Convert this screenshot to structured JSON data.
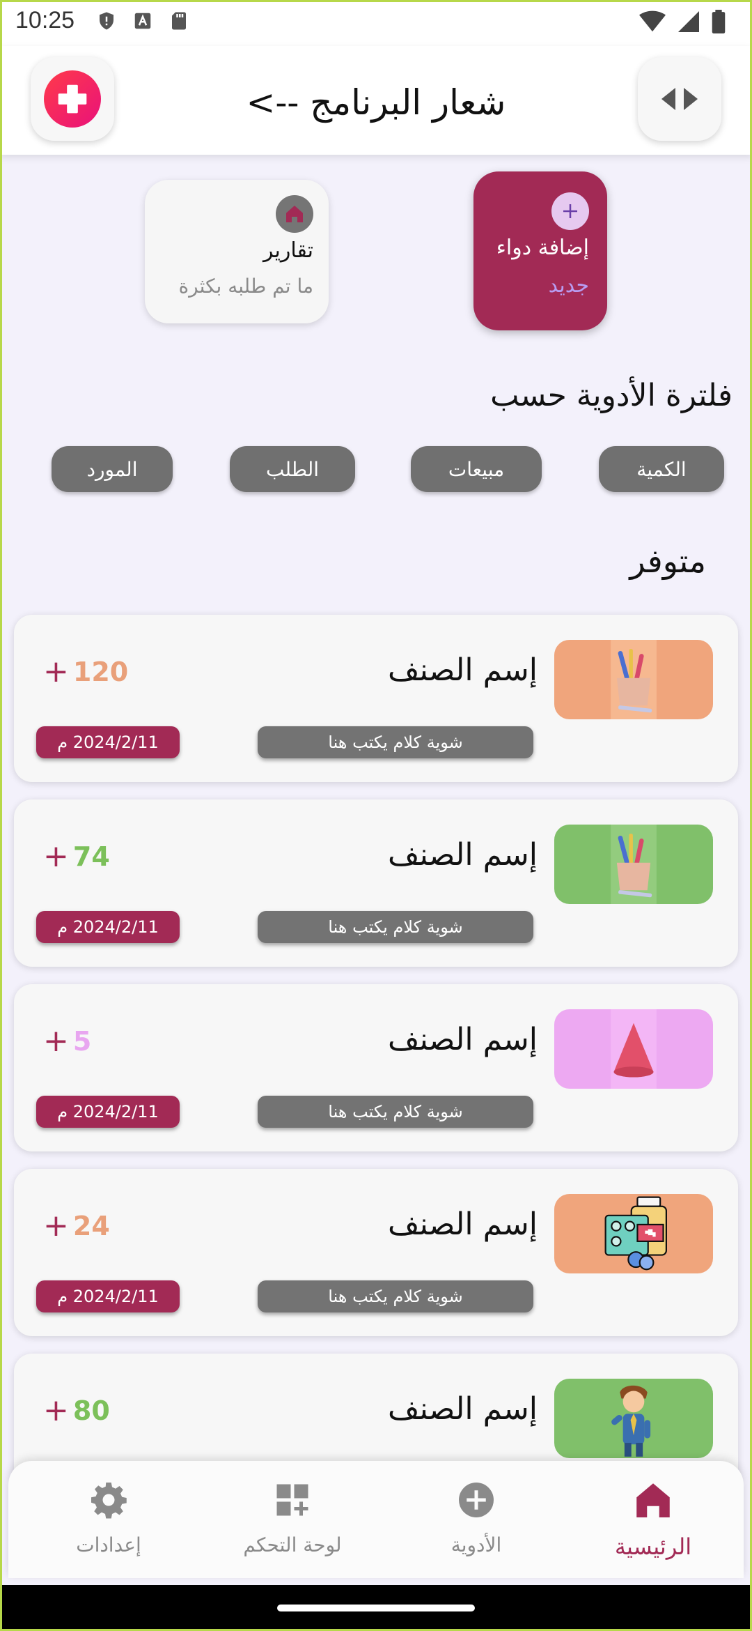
{
  "status_bar": {
    "time": "10:25"
  },
  "app_bar": {
    "title": "شعار البرنامج -->"
  },
  "quick_cards": {
    "reports": {
      "title": "تقارير",
      "subtitle": "ما تم طلبه بكثرة"
    },
    "add_medicine": {
      "title": "إضافة دواء",
      "subtitle": "جديد"
    }
  },
  "filter": {
    "title": "فلترة الأدوية حسب",
    "chips": [
      "الكمية",
      "مبيعات",
      "الطلب",
      "المورد"
    ]
  },
  "section": {
    "title": "متوفر"
  },
  "items": [
    {
      "name": "إسم الصنف",
      "quantity": "120",
      "qty_color": "#e9a07a",
      "description": "شوية كلام يكتب هنا",
      "date": "2024/2/11 م",
      "image_bg": "#f0a57c",
      "image_icon": "pencil-cup-icon"
    },
    {
      "name": "إسم الصنف",
      "quantity": "74",
      "qty_color": "#7cc05a",
      "description": "شوية كلام يكتب هنا",
      "date": "2024/2/11 م",
      "image_bg": "#80c06a",
      "image_icon": "pencil-cup-icon"
    },
    {
      "name": "إسم الصنف",
      "quantity": "5",
      "qty_color": "#e8a6f0",
      "description": "شوية كلام يكتب هنا",
      "date": "2024/2/11 م",
      "image_bg": "#eda9f2",
      "image_icon": "cone-icon"
    },
    {
      "name": "إسم الصنف",
      "quantity": "24",
      "qty_color": "#e9a07a",
      "description": "شوية كلام يكتب هنا",
      "date": "2024/2/11 م",
      "image_bg": "#f0a57c",
      "image_icon": "medicine-pack-icon"
    },
    {
      "name": "إسم الصنف",
      "quantity": "80",
      "qty_color": "#7cc05a",
      "image_bg": "#80c06a",
      "image_icon": "businessman-icon"
    }
  ],
  "bottom_nav": [
    {
      "label": "إعدادات",
      "icon": "gear-icon"
    },
    {
      "label": "لوحة التحكم",
      "icon": "dashboard-icon"
    },
    {
      "label": "الأدوية",
      "icon": "plus-circle-icon"
    },
    {
      "label": "الرئيسية",
      "icon": "home-icon",
      "active": true
    }
  ],
  "colors": {
    "accent": "#a22a55",
    "chip": "#707070",
    "background": "#f3f1fb"
  }
}
